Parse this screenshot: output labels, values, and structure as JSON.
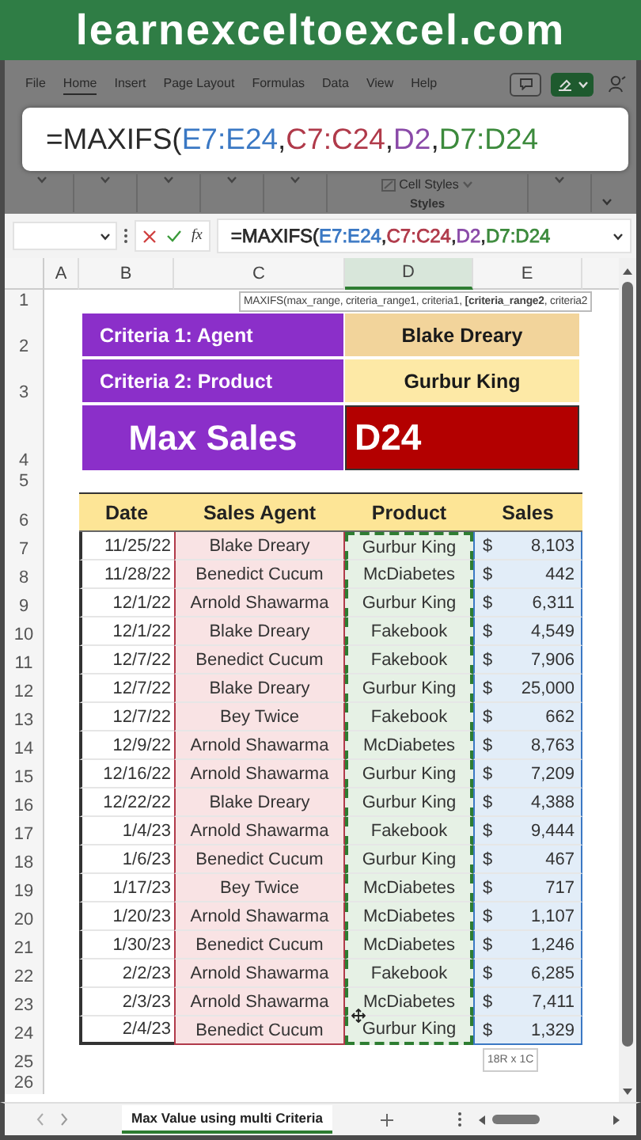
{
  "banner": {
    "text": "learnexceltoexcel.com"
  },
  "ribbon": {
    "tabs": [
      {
        "label": "File",
        "selected": false
      },
      {
        "label": "Home",
        "selected": true
      },
      {
        "label": "Insert",
        "selected": false
      },
      {
        "label": "Page Layout",
        "selected": false
      },
      {
        "label": "Formulas",
        "selected": false
      },
      {
        "label": "Data",
        "selected": false
      },
      {
        "label": "View",
        "selected": false
      },
      {
        "label": "Help",
        "selected": false
      }
    ],
    "cell_styles": "Cell Styles",
    "group_label": "Styles"
  },
  "formula_overlay": {
    "parts": [
      {
        "text": "=MAXIFS(",
        "color": "#2a2a2a"
      },
      {
        "text": "E7:E24",
        "color": "#3a78c4"
      },
      {
        "text": ",",
        "color": "#2a2a2a"
      },
      {
        "text": "C7:C24",
        "color": "#b03a4a"
      },
      {
        "text": ",",
        "color": "#2a2a2a"
      },
      {
        "text": "D2",
        "color": "#8a4aa8"
      },
      {
        "text": ",",
        "color": "#2a2a2a"
      },
      {
        "text": "D7:D24",
        "color": "#3c8a3c"
      }
    ]
  },
  "formula_bar": {
    "function_button": "fx",
    "parts": [
      {
        "text": "=MAXIFS(",
        "color": "#2a2a2a"
      },
      {
        "text": "E7:E24",
        "color": "#3a78c4"
      },
      {
        "text": ",",
        "color": "#2a2a2a"
      },
      {
        "text": "C7:C24",
        "color": "#b03a4a"
      },
      {
        "text": ",",
        "color": "#2a2a2a"
      },
      {
        "text": "D2",
        "color": "#8a4aa8"
      },
      {
        "text": ",",
        "color": "#2a2a2a"
      },
      {
        "text": "D7:D24",
        "color": "#3c8a3c"
      }
    ]
  },
  "sheet": {
    "columns": [
      {
        "label": "A",
        "selected": false
      },
      {
        "label": "B",
        "selected": false
      },
      {
        "label": "C",
        "selected": false
      },
      {
        "label": "D",
        "selected": true
      },
      {
        "label": "E",
        "selected": false
      }
    ],
    "row_numbers": [
      "1",
      "2",
      "3",
      "4",
      "5",
      "6",
      "7",
      "8",
      "9",
      "10",
      "11",
      "12",
      "13",
      "14",
      "15",
      "16",
      "17",
      "18",
      "19",
      "20",
      "21",
      "22",
      "23",
      "24",
      "25",
      "26"
    ],
    "tooltip": "MAXIFS(max_range, criteria_range1, criteria1, **[criteria_range2**, criteria2",
    "criteria": [
      {
        "label": "Criteria 1: Agent",
        "value": "Blake Dreary",
        "color": "#f2d49b"
      },
      {
        "label": "Criteria 2: Product",
        "value": "Gurbur King",
        "color": "#fde9a6"
      }
    ],
    "result": {
      "label": "Max Sales",
      "value": "D24"
    },
    "table": {
      "columns": [
        {
          "label": "Date",
          "color": "#ffffff",
          "outline": {
            "kind": "plain",
            "color": "#333333"
          }
        },
        {
          "label": "Sales Agent",
          "color": "#f9e3e4",
          "outline": {
            "kind": "range",
            "color": "#b03a4a"
          }
        },
        {
          "label": "Product",
          "color": "#e6f1e5",
          "outline": {
            "kind": "marquee",
            "color": "#2e7d32"
          }
        },
        {
          "label": "Sales",
          "color": "#e2edf8",
          "outline": {
            "kind": "range",
            "color": "#3a78c4"
          }
        }
      ],
      "rows": [
        {
          "date": "11/25/22",
          "agent": "Blake Dreary",
          "product": "Gurbur King",
          "currency": "$",
          "sales": "8,103"
        },
        {
          "date": "11/28/22",
          "agent": "Benedict Cucum",
          "product": "McDiabetes",
          "currency": "$",
          "sales": "442"
        },
        {
          "date": "12/1/22",
          "agent": "Arnold Shawarma",
          "product": "Gurbur King",
          "currency": "$",
          "sales": "6,311"
        },
        {
          "date": "12/1/22",
          "agent": "Blake Dreary",
          "product": "Fakebook",
          "currency": "$",
          "sales": "4,549"
        },
        {
          "date": "12/7/22",
          "agent": "Benedict Cucum",
          "product": "Fakebook",
          "currency": "$",
          "sales": "7,906"
        },
        {
          "date": "12/7/22",
          "agent": "Blake Dreary",
          "product": "Gurbur King",
          "currency": "$",
          "sales": "25,000"
        },
        {
          "date": "12/7/22",
          "agent": "Bey Twice",
          "product": "Fakebook",
          "currency": "$",
          "sales": "662"
        },
        {
          "date": "12/9/22",
          "agent": "Arnold Shawarma",
          "product": "McDiabetes",
          "currency": "$",
          "sales": "8,763"
        },
        {
          "date": "12/16/22",
          "agent": "Arnold Shawarma",
          "product": "Gurbur King",
          "currency": "$",
          "sales": "7,209"
        },
        {
          "date": "12/22/22",
          "agent": "Blake Dreary",
          "product": "Gurbur King",
          "currency": "$",
          "sales": "4,388"
        },
        {
          "date": "1/4/23",
          "agent": "Arnold Shawarma",
          "product": "Fakebook",
          "currency": "$",
          "sales": "9,444"
        },
        {
          "date": "1/6/23",
          "agent": "Benedict Cucum",
          "product": "Gurbur King",
          "currency": "$",
          "sales": "467"
        },
        {
          "date": "1/17/23",
          "agent": "Bey Twice",
          "product": "McDiabetes",
          "currency": "$",
          "sales": "717"
        },
        {
          "date": "1/20/23",
          "agent": "Arnold Shawarma",
          "product": "McDiabetes",
          "currency": "$",
          "sales": "1,107"
        },
        {
          "date": "1/30/23",
          "agent": "Benedict Cucum",
          "product": "McDiabetes",
          "currency": "$",
          "sales": "1,246"
        },
        {
          "date": "2/2/23",
          "agent": "Arnold Shawarma",
          "product": "Fakebook",
          "currency": "$",
          "sales": "6,285"
        },
        {
          "date": "2/3/23",
          "agent": "Arnold Shawarma",
          "product": "McDiabetes",
          "currency": "$",
          "sales": "7,411"
        },
        {
          "date": "2/4/23",
          "agent": "Benedict Cucum",
          "product": "Gurbur King",
          "currency": "$",
          "sales": "1,329"
        }
      ]
    },
    "selection_size": "18R x 1C"
  },
  "sheet_tabs": [
    {
      "label": "Max Value using multi Criteria",
      "selected": true
    }
  ]
}
